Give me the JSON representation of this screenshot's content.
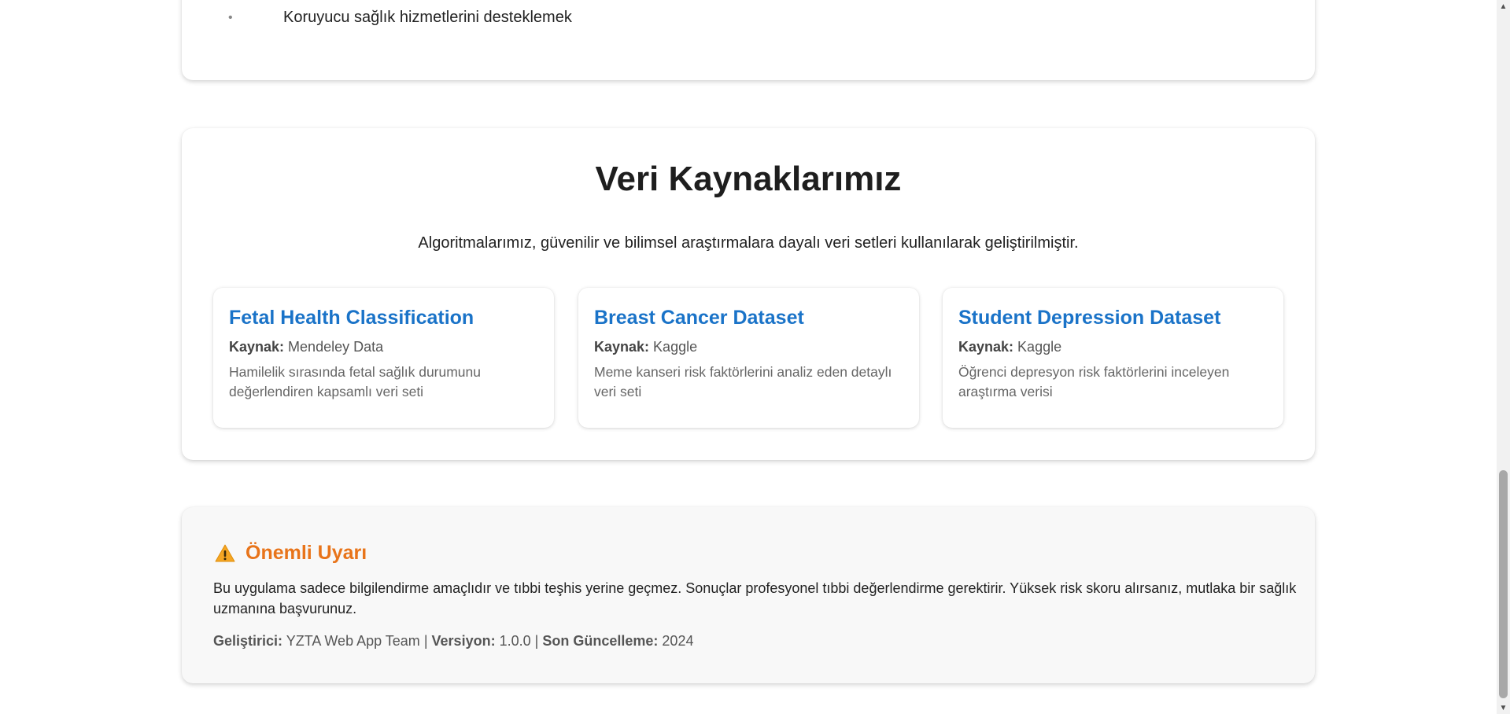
{
  "top_card": {
    "bullet_item": "Koruyucu sağlık hizmetlerini desteklemek"
  },
  "sources": {
    "title": "Veri Kaynaklarımız",
    "subtitle": "Algoritmalarımız, güvenilir ve bilimsel araştırmalara dayalı veri setleri kullanılarak geliştirilmiştir.",
    "source_label": "Kaynak:",
    "datasets": [
      {
        "title": "Fetal Health Classification",
        "source": "Mendeley Data",
        "description": "Hamilelik sırasında fetal sağlık durumunu değerlendiren kapsamlı veri seti"
      },
      {
        "title": "Breast Cancer Dataset",
        "source": "Kaggle",
        "description": "Meme kanseri risk faktörlerini analiz eden detaylı veri seti"
      },
      {
        "title": "Student Depression Dataset",
        "source": "Kaggle",
        "description": "Öğrenci depresyon risk faktörlerini inceleyen araştırma verisi"
      }
    ]
  },
  "warning": {
    "icon": "warning-icon",
    "title": "Önemli Uyarı",
    "text": "Bu uygulama sadece bilgilendirme amaçlıdır ve tıbbi teşhis yerine geçmez. Sonuçlar profesyonel tıbbi değerlendirme gerektirir. Yüksek risk skoru alırsanız, mutlaka bir sağlık uzmanına başvurunuz.",
    "developer_label": "Geliştirici:",
    "developer": "YZTA Web App Team",
    "version_label": "Versiyon:",
    "version": "1.0.0",
    "updated_label": "Son Güncelleme:",
    "updated": "2024",
    "separator": "|"
  },
  "colors": {
    "accent_blue": "#1a73c8",
    "warning_orange": "#e8741a"
  }
}
